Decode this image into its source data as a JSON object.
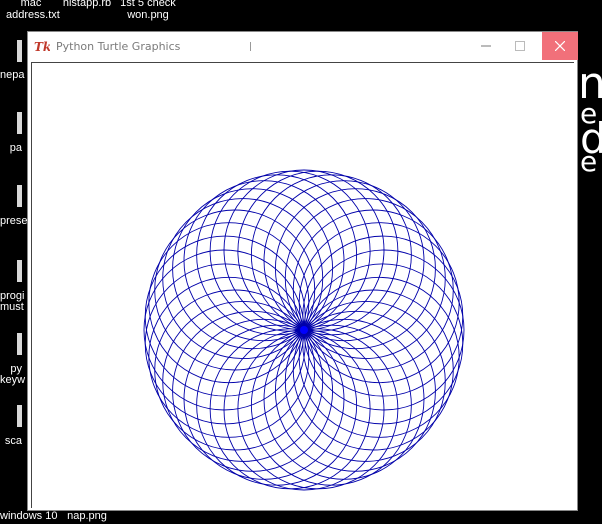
{
  "desktop": {
    "top_labels": [
      {
        "line1": "mac",
        "line2": "address.txt"
      },
      {
        "line1": "histapp.rb",
        "line2": ""
      },
      {
        "line1": "1st 5 check",
        "line2": "won.png"
      }
    ],
    "left_labels": [
      "nepa",
      "pa",
      "prese",
      "progi",
      "must",
      "py",
      "keyw",
      "sca"
    ],
    "bottom_labels": [
      "windows 10",
      "nap.png"
    ],
    "right_glyphs": [
      "n",
      "e",
      "d",
      "e"
    ]
  },
  "window": {
    "title": "Python Turtle Graphics",
    "controls": {
      "minimize": "—",
      "maximize": "☐",
      "close": "✕"
    },
    "accent_close": "#f1707a"
  },
  "drawing": {
    "pattern": "spirograph",
    "circle_count": 36,
    "stroke_color": "#0000aa",
    "center_color": "#0000ff",
    "background": "#ffffff"
  }
}
